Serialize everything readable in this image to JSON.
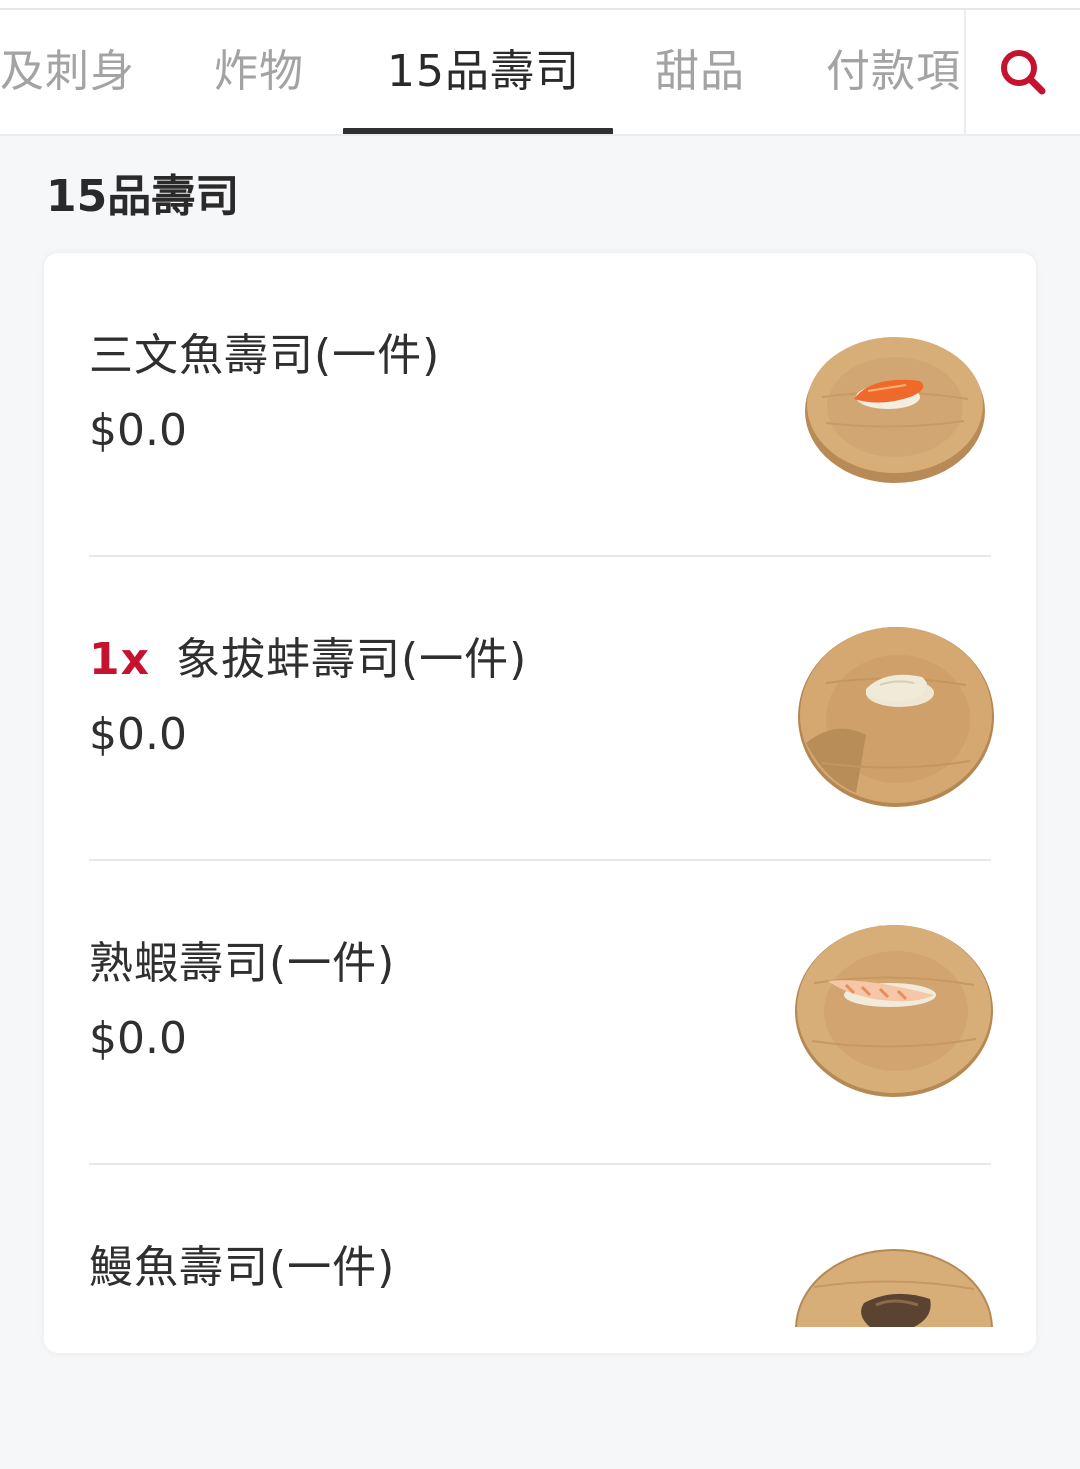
{
  "tabs": [
    {
      "label": "及刺身",
      "active": false
    },
    {
      "label": "炸物",
      "active": false
    },
    {
      "label": "15品壽司",
      "active": true
    },
    {
      "label": "甜品",
      "active": false
    },
    {
      "label": "付款項目",
      "active": false
    }
  ],
  "search_icon": "search-icon",
  "accent_color": "#c4122f",
  "section": {
    "title": "15品壽司"
  },
  "items": [
    {
      "qty": "",
      "name": "三文魚壽司(一件)",
      "price": "$0.0",
      "image": "salmon-nigiri-on-wooden-plate"
    },
    {
      "qty": "1x",
      "name": "象拔蚌壽司(一件)",
      "price": "$0.0",
      "image": "geoduck-nigiri-on-wooden-plate"
    },
    {
      "qty": "",
      "name": "熟蝦壽司(一件)",
      "price": "$0.0",
      "image": "cooked-shrimp-nigiri-on-wooden-plate"
    },
    {
      "qty": "",
      "name": "鰻魚壽司(一件)",
      "price": "",
      "image": "eel-nigiri-on-wooden-plate"
    }
  ]
}
